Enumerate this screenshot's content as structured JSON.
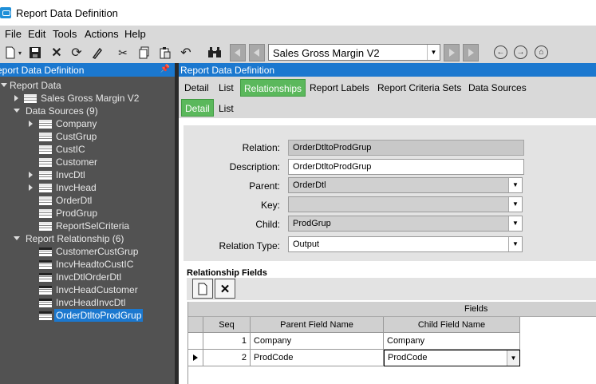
{
  "window": {
    "title": "Report Data Definition"
  },
  "menu": [
    "File",
    "Edit",
    "Tools",
    "Actions",
    "Help"
  ],
  "navigator": {
    "value": "Sales Gross Margin V2"
  },
  "left_panel": {
    "title": "eport Data Definition"
  },
  "tree": {
    "root": "Report Data",
    "report": "Sales Gross Margin V2",
    "data_sources_label": "Data Sources (9)",
    "data_sources": [
      "Company",
      "CustGrup",
      "CustIC",
      "Customer",
      "InvcDtl",
      "InvcHead",
      "OrderDtl",
      "ProdGrup",
      "ReportSelCriteria"
    ],
    "relationships_label": "Report Relationship (6)",
    "relationships": [
      "CustomerCustGrup",
      "IncvHeadtoCustIC",
      "InvcDtlOrderDtl",
      "InvcHeadCustomer",
      "InvcHeadInvcDtl",
      "OrderDtltoProdGrup"
    ]
  },
  "right_panel": {
    "title": "Report Data Definition"
  },
  "tabs": [
    "Detail",
    "List",
    "Relationships",
    "Report Labels",
    "Report Criteria Sets",
    "Data Sources"
  ],
  "subtabs": [
    "Detail",
    "List"
  ],
  "form": {
    "relation_label": "Relation:",
    "relation_value": "OrderDtltoProdGrup",
    "description_label": "Description:",
    "description_value": "OrderDtltoProdGrup",
    "parent_label": "Parent:",
    "parent_value": "OrderDtl",
    "key_label": "Key:",
    "key_value": "",
    "child_label": "Child:",
    "child_value": "ProdGrup",
    "relation_type_label": "Relation Type:",
    "relation_type_value": "Output"
  },
  "grid": {
    "title": "Relationship Fields",
    "band": "Fields",
    "headers": [
      "Seq",
      "Parent Field Name",
      "Child Field Name"
    ],
    "rows": [
      {
        "seq": "1",
        "parent": "Company",
        "child": "Company"
      },
      {
        "seq": "2",
        "parent": "ProdCode",
        "child": "ProdCode"
      }
    ]
  }
}
